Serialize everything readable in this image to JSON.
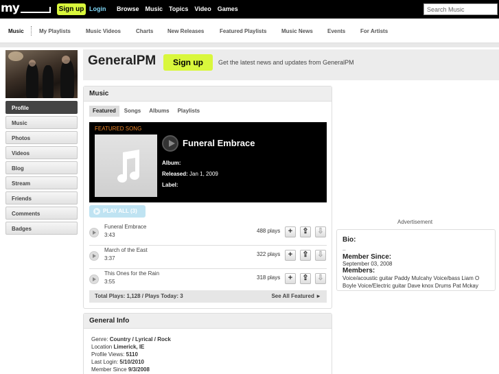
{
  "topbar": {
    "logo": "my",
    "signup_label": "Sign up",
    "login_label": "Login",
    "nav": [
      "Browse",
      "Music",
      "Topics",
      "Video",
      "Games"
    ],
    "search_placeholder": "Search Music"
  },
  "subnav": {
    "items": [
      "Music",
      "My Playlists",
      "Music Videos",
      "Charts",
      "New Releases",
      "Featured Playlists",
      "Music News",
      "Events",
      "For Artists"
    ]
  },
  "sidebar": {
    "items": [
      "Profile",
      "Music",
      "Photos",
      "Videos",
      "Blog",
      "Stream",
      "Friends",
      "Comments",
      "Badges"
    ],
    "active": "Profile"
  },
  "header": {
    "title": "GeneralPM",
    "signup_label": "Sign up",
    "tagline": "Get the latest news and updates from GeneralPM"
  },
  "music": {
    "panel_title": "Music",
    "tabs": [
      "Featured",
      "Songs",
      "Albums",
      "Playlists"
    ],
    "featured": {
      "label": "FEATURED SONG",
      "title": "Funeral Embrace",
      "album_label": "Album:",
      "album_value": "",
      "released_label": "Released:",
      "released_value": "Jan 1, 2009",
      "label_label": "Label:",
      "label_value": ""
    },
    "play_all_label": "PLAY ALL (3)",
    "songs": [
      {
        "name": "Funeral Embrace",
        "duration": "3:43",
        "plays": "488 plays"
      },
      {
        "name": "March of the East",
        "duration": "3:37",
        "plays": "322 plays"
      },
      {
        "name": "This Ones for the Rain",
        "duration": "3:55",
        "plays": "318 plays"
      }
    ],
    "totals": "Total Plays: 1,128 / Plays Today: 3",
    "see_all": "See All Featured ►"
  },
  "general_info": {
    "title": "General Info",
    "genre_label": "Genre:",
    "genre_value": "Country / Lyrical / Rock",
    "location_label": "Location",
    "location_value": "Limerick, IE",
    "views_label": "Profile Views:",
    "views_value": "5110",
    "login_label": "Last Login:",
    "login_value": "5/10/2010",
    "since_label": "Member Since",
    "since_value": "9/3/2008"
  },
  "right": {
    "ad_label": "Advertisement",
    "bio_title": "Bio:",
    "bio_text": "..",
    "member_since_title": "Member Since:",
    "member_since_value": "September 03, 2008",
    "members_title": "Members:",
    "members_text": "Voice/acoustic guitar Paddy Mulcahy Voice/bass Liam O Boyle Voice/Electric guitar Dave knox Drums Pat Mckay"
  },
  "colors": {
    "signup_accent": "#d9f73c",
    "login_link": "#7ed6f5",
    "featured_label": "#f0872a",
    "play_all": "#bfe3f2"
  }
}
